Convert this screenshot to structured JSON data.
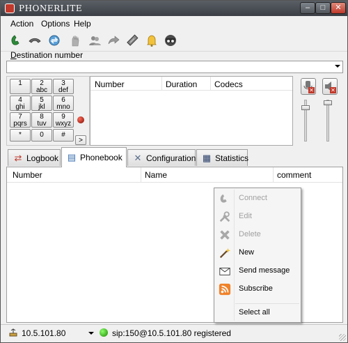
{
  "window": {
    "title": "PHONERLITE",
    "min_glyph": "–",
    "max_glyph": "□",
    "close_glyph": "✕"
  },
  "menu": {
    "action": "Action",
    "options": "Options",
    "help": "Help"
  },
  "toolbar": {
    "icons": [
      "phone-icon",
      "hangup-icon",
      "transfer-icon",
      "hold-icon",
      "conference-icon",
      "forward-icon",
      "pen-icon",
      "bell-icon",
      "incognito-icon"
    ]
  },
  "destination": {
    "label_prefix": "D",
    "label_rest": "estination number",
    "value": ""
  },
  "keypad": {
    "keys": [
      {
        "main": "1",
        "sub": ""
      },
      {
        "main": "2",
        "sub": "abc"
      },
      {
        "main": "3",
        "sub": "def"
      },
      {
        "main": "4",
        "sub": "ghi"
      },
      {
        "main": "5",
        "sub": "jkl"
      },
      {
        "main": "6",
        "sub": "mno"
      },
      {
        "main": "7",
        "sub": "pqrs"
      },
      {
        "main": "8",
        "sub": "tuv"
      },
      {
        "main": "9",
        "sub": "wxyz"
      },
      {
        "main": "*",
        "sub": ""
      },
      {
        "main": "0",
        "sub": ""
      },
      {
        "main": "#",
        "sub": ""
      }
    ],
    "more": ">"
  },
  "call_table": {
    "columns": [
      "Number",
      "Duration",
      "Codecs"
    ]
  },
  "tabs": [
    {
      "label": "Logbook",
      "icon": "logbook-icon",
      "active": false
    },
    {
      "label": "Phonebook",
      "icon": "phonebook-icon",
      "active": true
    },
    {
      "label": "Configuration",
      "icon": "configuration-icon",
      "active": false
    },
    {
      "label": "Statistics",
      "icon": "statistics-icon",
      "active": false
    }
  ],
  "phonebook": {
    "columns": [
      "Number",
      "Name",
      "comment"
    ]
  },
  "context_menu": {
    "items": [
      {
        "label": "Connect",
        "icon": "phone-icon",
        "enabled": false
      },
      {
        "label": "Edit",
        "icon": "tools-icon",
        "enabled": false
      },
      {
        "label": "Delete",
        "icon": "delete-icon",
        "enabled": false
      },
      {
        "label": "New",
        "icon": "magic-wand-icon",
        "enabled": true
      },
      {
        "label": "Send message",
        "icon": "envelope-icon",
        "enabled": true
      },
      {
        "label": "Subscribe",
        "icon": "rss-icon",
        "enabled": true
      },
      {
        "label": "Select all",
        "icon": "",
        "enabled": true
      }
    ]
  },
  "status": {
    "ip": "10.5.101.80",
    "registration": "sip:150@10.5.101.80 registered"
  },
  "colors": {
    "rss": "#f0822a",
    "delete": "#c0392b",
    "led_green": "#2eb82e",
    "led_red": "#a01800"
  }
}
